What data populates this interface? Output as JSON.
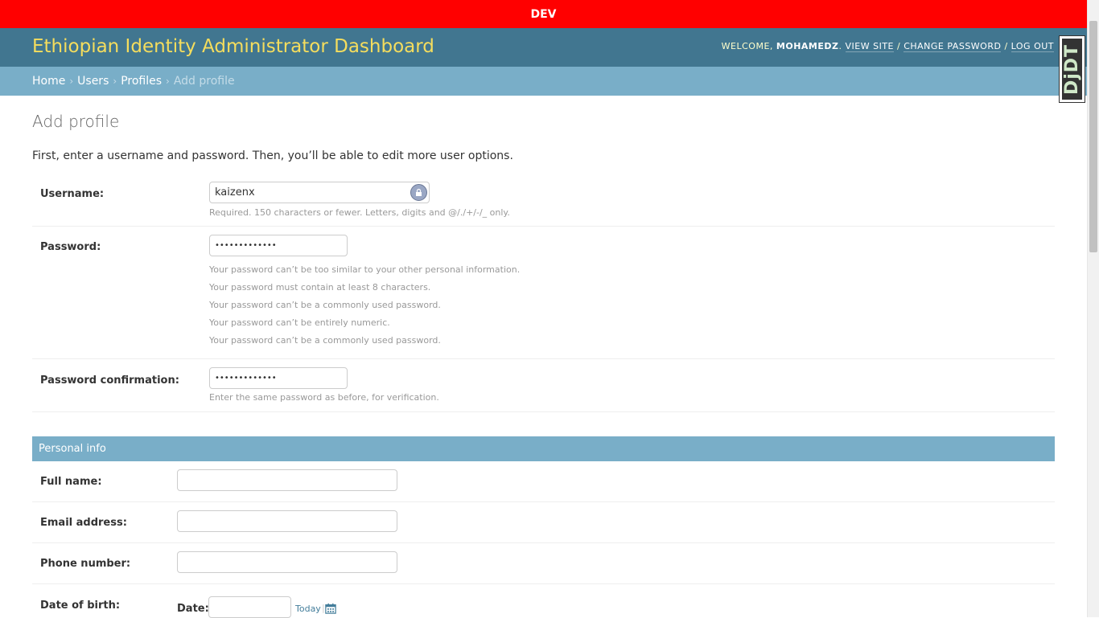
{
  "env_bar": {
    "label": "DEV"
  },
  "header": {
    "title": "Ethiopian Identity Administrator Dashboard",
    "welcome": "Welcome,",
    "username": "MOHAMEDZ",
    "view_site": "View site",
    "change_password": "Change password",
    "log_out": "Log out"
  },
  "breadcrumbs": {
    "home": "Home",
    "users": "Users",
    "profiles": "Profiles",
    "current": "Add profile"
  },
  "debug_toolbar": {
    "label": "DjDT"
  },
  "page": {
    "title": "Add profile",
    "intro": "First, enter a username and password. Then, you’ll be able to edit more user options."
  },
  "form": {
    "username": {
      "label": "Username:",
      "value": "kaizenx",
      "help": "Required. 150 characters or fewer. Letters, digits and @/./+/-/_ only."
    },
    "password": {
      "label": "Password:",
      "value": "•••••••••••••",
      "help": [
        "Your password can’t be too similar to your other personal information.",
        "Your password must contain at least 8 characters.",
        "Your password can’t be a commonly used password.",
        "Your password can’t be entirely numeric.",
        "Your password can’t be a commonly used password."
      ]
    },
    "password_confirmation": {
      "label": "Password confirmation:",
      "value": "•••••••••••••",
      "help": "Enter the same password as before, for verification."
    }
  },
  "personal_info": {
    "caption": "Personal info",
    "full_name": {
      "label": "Full name:",
      "value": ""
    },
    "email": {
      "label": "Email address:",
      "value": ""
    },
    "phone": {
      "label": "Phone number:",
      "value": ""
    },
    "dob": {
      "label": "Date of birth:",
      "date_label": "Date:",
      "today": "Today",
      "separator": "|"
    }
  },
  "colors": {
    "env_bar": "#ff0000",
    "header": "#417690",
    "title": "#f5dd5d",
    "breadcrumbs": "#79aec8",
    "link": "#447e9b"
  },
  "icons": {
    "password_manager": "lastpass-icon",
    "calendar": "calendar-icon"
  }
}
